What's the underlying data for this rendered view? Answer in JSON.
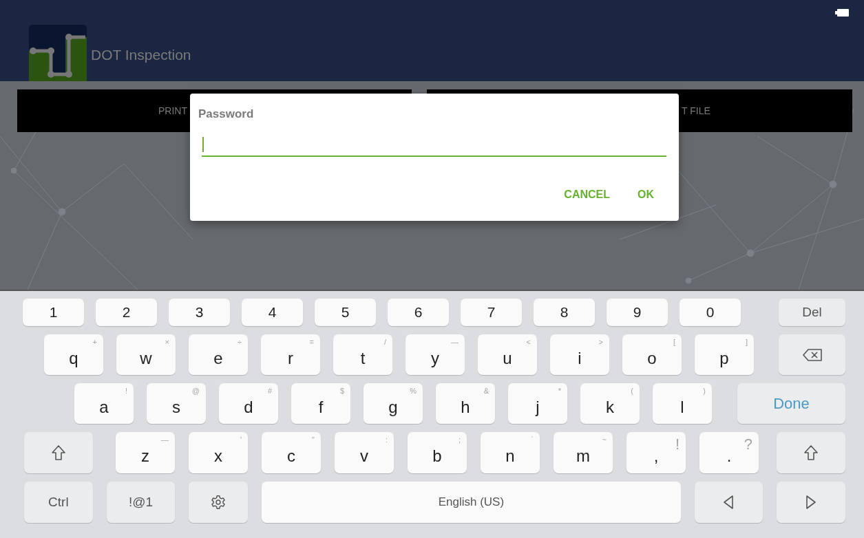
{
  "app_bar": {
    "title": "DOT Inspection"
  },
  "actions": [
    {
      "label": "PRINT"
    },
    {
      "label": "T FILE"
    }
  ],
  "dialog": {
    "title": "Password",
    "field": {
      "focused": true
    },
    "buttons": [
      {
        "label": "CANCEL"
      },
      {
        "label": "OK"
      }
    ]
  },
  "keyboard": {
    "rows": [
      {
        "keys": [
          {
            "kind": "num",
            "label": "1"
          },
          {
            "kind": "num",
            "label": "2"
          },
          {
            "kind": "num",
            "label": "3"
          },
          {
            "kind": "num",
            "label": "4"
          },
          {
            "kind": "num",
            "label": "5"
          },
          {
            "kind": "num",
            "label": "6"
          },
          {
            "kind": "num",
            "label": "7"
          },
          {
            "kind": "num",
            "label": "8"
          },
          {
            "kind": "num",
            "label": "9"
          },
          {
            "kind": "num",
            "label": "0"
          },
          {
            "kind": "del",
            "label": "Del"
          }
        ]
      },
      {
        "keys": [
          {
            "kind": "letter",
            "label": "q",
            "hint": "+"
          },
          {
            "kind": "letter",
            "label": "w",
            "hint": "×"
          },
          {
            "kind": "letter",
            "label": "e",
            "hint": "÷"
          },
          {
            "kind": "letter",
            "label": "r",
            "hint": "="
          },
          {
            "kind": "letter",
            "label": "t",
            "hint": "/"
          },
          {
            "kind": "letter",
            "label": "y",
            "hint": "—"
          },
          {
            "kind": "letter",
            "label": "u",
            "hint": "<"
          },
          {
            "kind": "letter",
            "label": "i",
            "hint": ">"
          },
          {
            "kind": "letter",
            "label": "o",
            "hint": "["
          },
          {
            "kind": "letter",
            "label": "p",
            "hint": "]"
          },
          {
            "kind": "backspace"
          }
        ]
      },
      {
        "keys": [
          {
            "kind": "letter",
            "label": "a",
            "hint": "!"
          },
          {
            "kind": "letter",
            "label": "s",
            "hint": "@"
          },
          {
            "kind": "letter",
            "label": "d",
            "hint": "#"
          },
          {
            "kind": "letter",
            "label": "f",
            "hint": "$"
          },
          {
            "kind": "letter",
            "label": "g",
            "hint": "%"
          },
          {
            "kind": "letter",
            "label": "h",
            "hint": "&"
          },
          {
            "kind": "letter",
            "label": "j",
            "hint": "*"
          },
          {
            "kind": "letter",
            "label": "k",
            "hint": "("
          },
          {
            "kind": "letter",
            "label": "l",
            "hint": ")"
          },
          {
            "kind": "done",
            "label": "Done"
          }
        ]
      },
      {
        "keys": [
          {
            "kind": "shift"
          },
          {
            "kind": "letter",
            "label": "z",
            "hint": "—"
          },
          {
            "kind": "letter",
            "label": "x",
            "hint": "'"
          },
          {
            "kind": "letter",
            "label": "c",
            "hint": "\""
          },
          {
            "kind": "letter",
            "label": "v",
            "hint": ":"
          },
          {
            "kind": "letter",
            "label": "b",
            "hint": ";"
          },
          {
            "kind": "letter",
            "label": "n",
            "hint": "`"
          },
          {
            "kind": "letter",
            "label": "m",
            "hint": "~"
          },
          {
            "kind": "punct",
            "label": ",",
            "hint": "!"
          },
          {
            "kind": "punct",
            "label": ".",
            "hint": "?"
          },
          {
            "kind": "shift"
          }
        ]
      },
      {
        "keys": [
          {
            "kind": "mod",
            "label": "Ctrl"
          },
          {
            "kind": "mod",
            "label": "!@1"
          },
          {
            "kind": "settings"
          },
          {
            "kind": "space",
            "label": "English (US)"
          },
          {
            "kind": "left"
          },
          {
            "kind": "right"
          }
        ]
      }
    ]
  }
}
